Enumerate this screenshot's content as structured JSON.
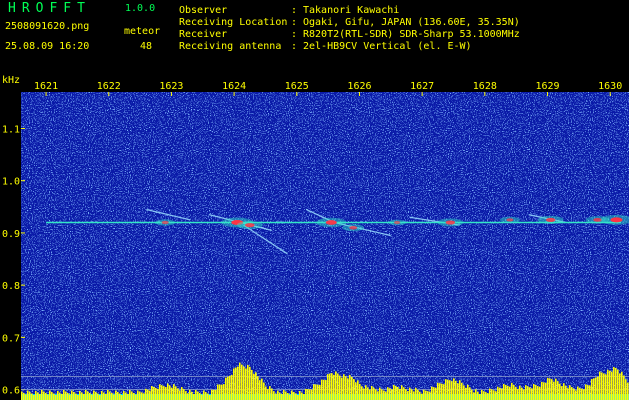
{
  "header": {
    "app_title": "HROFFT",
    "version": "1.0.0",
    "file_name": "2508091620.png",
    "datetime": "25.08.09 16:20",
    "meteor_label": "meteor",
    "meteor_count": "48"
  },
  "station_info": [
    {
      "label": "Observer",
      "value": "Takanori Kawachi"
    },
    {
      "label": "Receiving Location",
      "value": "Ogaki, Gifu, JAPAN (136.60E, 35.35N)"
    },
    {
      "label": "Receiver",
      "value": "R820T2(RTL-SDR) SDR-Sharp 53.1000MHz"
    },
    {
      "label": "Receiving antenna",
      "value": "2el-HB9CV Vertical (el. E-W)"
    }
  ],
  "plot": {
    "y_unit": "kHz",
    "x_ticks": [
      "1621",
      "1622",
      "1623",
      "1624",
      "1625",
      "1626",
      "1627",
      "1628",
      "1629",
      "1630"
    ],
    "y_ticks": [
      "1.1",
      "1.0",
      "0.9",
      "0.8",
      "0.7",
      "0.6"
    ],
    "x_range": [
      1620.6,
      1630.3
    ],
    "y_range": [
      0.58,
      1.17
    ],
    "carrier_khz": 0.92,
    "meteor_events": [
      {
        "time": 1622.9,
        "freq": 0.92,
        "intensity": 0.4
      },
      {
        "time": 1624.05,
        "freq": 0.92,
        "intensity": 1.0
      },
      {
        "time": 1624.25,
        "freq": 0.915,
        "intensity": 0.7
      },
      {
        "time": 1625.55,
        "freq": 0.92,
        "intensity": 0.9
      },
      {
        "time": 1625.9,
        "freq": 0.91,
        "intensity": 0.5
      },
      {
        "time": 1626.6,
        "freq": 0.92,
        "intensity": 0.3
      },
      {
        "time": 1627.45,
        "freq": 0.92,
        "intensity": 0.7
      },
      {
        "time": 1628.4,
        "freq": 0.925,
        "intensity": 0.4
      },
      {
        "time": 1629.05,
        "freq": 0.925,
        "intensity": 0.7
      },
      {
        "time": 1629.8,
        "freq": 0.925,
        "intensity": 0.6
      },
      {
        "time": 1630.1,
        "freq": 0.925,
        "intensity": 1.0
      }
    ],
    "meteor_trails": [
      {
        "t0": 1623.6,
        "f0": 0.935,
        "t1": 1624.6,
        "f1": 0.905
      },
      {
        "t0": 1624.15,
        "f0": 0.915,
        "t1": 1624.85,
        "f1": 0.86
      },
      {
        "t0": 1625.15,
        "f0": 0.945,
        "t1": 1625.6,
        "f1": 0.92
      },
      {
        "t0": 1625.6,
        "f0": 0.92,
        "t1": 1626.5,
        "f1": 0.895
      },
      {
        "t0": 1622.6,
        "f0": 0.945,
        "t1": 1623.3,
        "f1": 0.925
      },
      {
        "t0": 1626.8,
        "f0": 0.93,
        "t1": 1627.6,
        "f1": 0.915
      },
      {
        "t0": 1628.7,
        "f0": 0.935,
        "t1": 1629.3,
        "f1": 0.92
      }
    ],
    "colors": {
      "background": "#0a1aa8",
      "carrier": "#33e6c8",
      "trail": "#99ddff",
      "hot": "#ff3344",
      "level": "#ffff00",
      "level_base": "#00d8ff",
      "guide_line": "#8899cc"
    }
  }
}
